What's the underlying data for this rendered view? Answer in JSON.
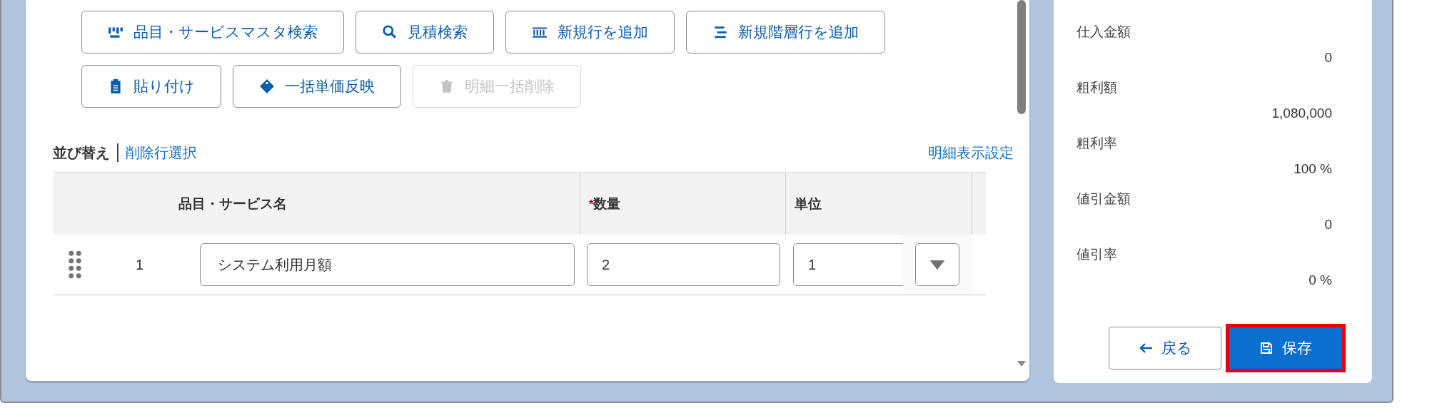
{
  "toolbar": {
    "rows": [
      [
        {
          "label": "品目・サービスマスタ検索",
          "disabled": false
        },
        {
          "label": "見積検索",
          "disabled": false
        },
        {
          "label": "新規行を追加",
          "disabled": false
        },
        {
          "label": "新規階層行を追加",
          "disabled": false
        }
      ],
      [
        {
          "label": "貼り付け",
          "disabled": false
        },
        {
          "label": "一括単価反映",
          "disabled": false
        },
        {
          "label": "明細一括削除",
          "disabled": true
        }
      ]
    ]
  },
  "list_bar": {
    "sort": "並び替え",
    "select_deleted": "削除行選択",
    "display_settings": "明細表示設定"
  },
  "table": {
    "required_mark": "*",
    "columns": [
      {
        "label": "品目・サービス名",
        "required": false
      },
      {
        "label": "数量",
        "required": true
      },
      {
        "label": "単位",
        "required": false
      }
    ],
    "rows": [
      {
        "number": "1",
        "name": "システム利用月額",
        "quantity": "2",
        "unit": "1"
      }
    ]
  },
  "summary": [
    {
      "label": "仕入金額",
      "value": "0"
    },
    {
      "label": "粗利額",
      "value": "1,080,000"
    },
    {
      "label": "粗利率",
      "value": "100 %"
    },
    {
      "label": "値引金額",
      "value": "0"
    },
    {
      "label": "値引率",
      "value": "0 %"
    }
  ],
  "actions": {
    "back": "戻る",
    "save": {
      "label": "保存",
      "highlighted": true
    }
  }
}
